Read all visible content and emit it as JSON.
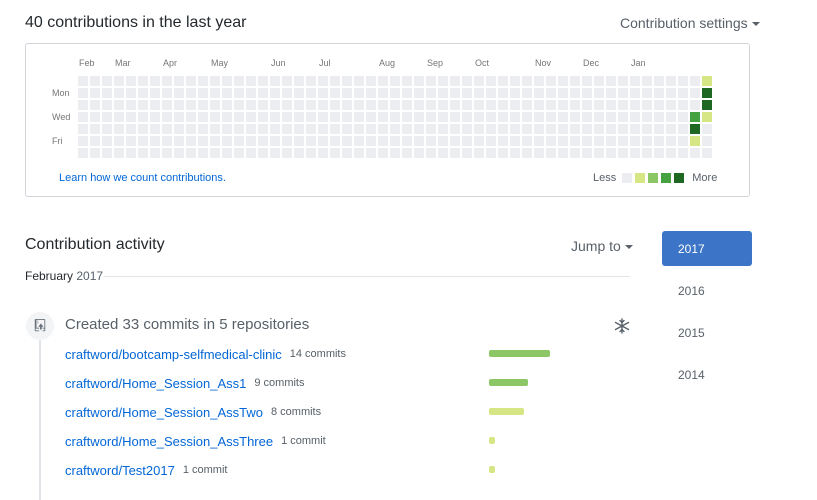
{
  "header": {
    "title": "40 contributions in the last year",
    "settings_label": "Contribution settings"
  },
  "calendar": {
    "months": [
      "Feb",
      "Mar",
      "Apr",
      "May",
      "Jun",
      "Jul",
      "Aug",
      "Sep",
      "Oct",
      "Nov",
      "Dec",
      "Jan"
    ],
    "month_week_index": [
      0,
      3,
      7,
      11,
      16,
      20,
      25,
      29,
      33,
      38,
      42,
      46
    ],
    "days": [
      "Mon",
      "Wed",
      "Fri"
    ],
    "day_row_index": [
      1,
      3,
      5
    ],
    "weeks": 53,
    "colors": [
      "#ebedf0",
      "#d6e685",
      "#8cc665",
      "#44a340",
      "#1e6823"
    ],
    "filled_weeks_from": 51,
    "levels_tail": [
      [
        0,
        0,
        0,
        0,
        0,
        0,
        0
      ],
      [
        0,
        0,
        0,
        3,
        4,
        1,
        0
      ],
      [
        1,
        4,
        4,
        1,
        0,
        0,
        0
      ]
    ],
    "learn_link": "Learn how we count contributions.",
    "legend_less": "Less",
    "legend_more": "More"
  },
  "activity": {
    "title": "Contribution activity",
    "jump_label": "Jump to",
    "period_month": "February",
    "period_year": "2017",
    "summary": "Created 33 commits in 5 repositories",
    "repos": [
      {
        "name": "craftword/bootcamp-selfmedical-clinic",
        "count_label": "14 commits",
        "commits": 14,
        "color": "#8cc665"
      },
      {
        "name": "craftword/Home_Session_Ass1",
        "count_label": "9 commits",
        "commits": 9,
        "color": "#8cc665"
      },
      {
        "name": "craftword/Home_Session_AssTwo",
        "count_label": "8 commits",
        "commits": 8,
        "color": "#d6e685"
      },
      {
        "name": "craftword/Home_Session_AssThree",
        "count_label": "1 commit",
        "commits": 1,
        "color": "#d6e685"
      },
      {
        "name": "craftword/Test2017",
        "count_label": "1 commit",
        "commits": 1,
        "color": "#d6e685"
      }
    ]
  },
  "years": [
    {
      "label": "2017",
      "selected": true
    },
    {
      "label": "2016",
      "selected": false
    },
    {
      "label": "2015",
      "selected": false
    },
    {
      "label": "2014",
      "selected": false
    }
  ],
  "icons": [
    "repo-push-icon",
    "unfold-icon",
    "caret-down-icon"
  ]
}
